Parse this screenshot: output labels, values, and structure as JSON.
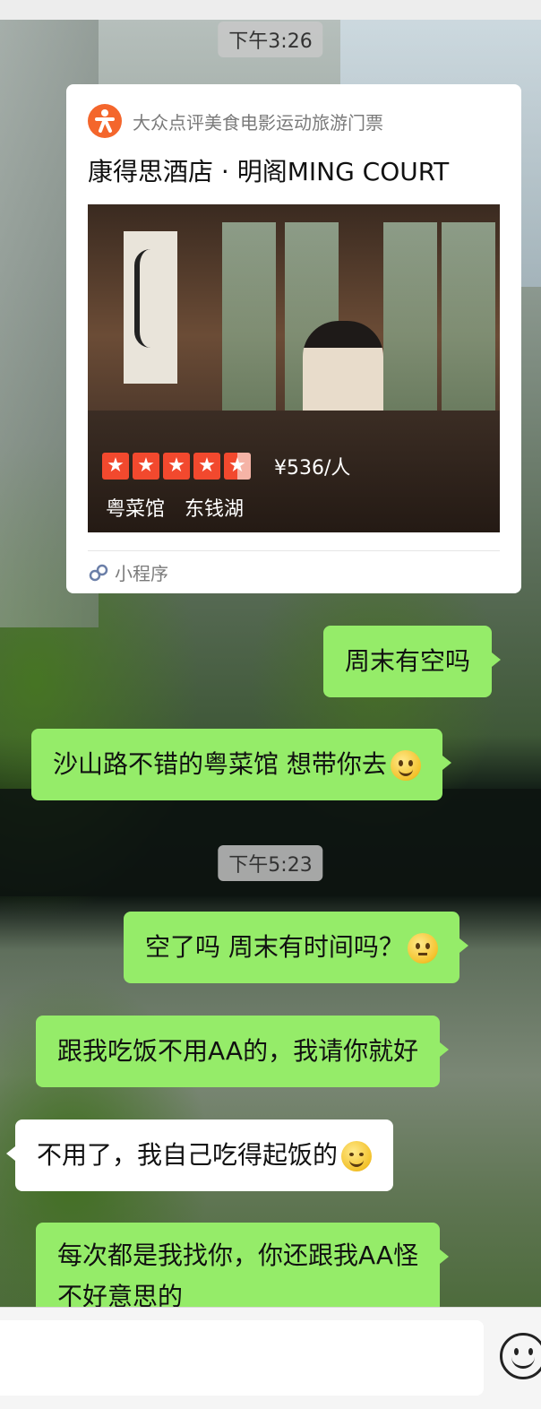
{
  "timestamps": [
    "下午3:26",
    "下午5:23"
  ],
  "mini_program_card": {
    "source_name": "大众点评美食电影运动旅游门票",
    "source_icon": "dianping-logo-icon",
    "title": "康得思酒店 · 明阁MING COURT",
    "rating_stars": 4.5,
    "price": "¥536/人",
    "tags": [
      "粤菜馆",
      "东钱湖"
    ],
    "footer_label": "小程序"
  },
  "messages": [
    {
      "side": "out",
      "lines": [
        "周末有空吗"
      ]
    },
    {
      "side": "out",
      "lines": [
        "沙山路不错的粤菜馆 想带你去"
      ],
      "emoji": "grin-emoji"
    },
    {
      "side": "out",
      "lines": [
        "空了吗 周末有时间吗？"
      ],
      "emoji": "dizzy-emoji"
    },
    {
      "side": "out",
      "lines": [
        "跟我吃饭不用AA的，我请你就好"
      ]
    },
    {
      "side": "in",
      "lines": [
        "不用了，我自己吃得起饭的"
      ],
      "emoji": "smile-emoji"
    },
    {
      "side": "out",
      "lines": [
        "每次都是我找你，你还跟我AA怪",
        "不好意思的"
      ]
    }
  ],
  "colors": {
    "outgoing_bubble": "#95ec69",
    "incoming_bubble": "#ffffff",
    "rating_star": "#f2492e",
    "dianping_orange": "#f4662c"
  },
  "input_bar": {
    "emoji_button_icon": "smiley-face-icon"
  }
}
